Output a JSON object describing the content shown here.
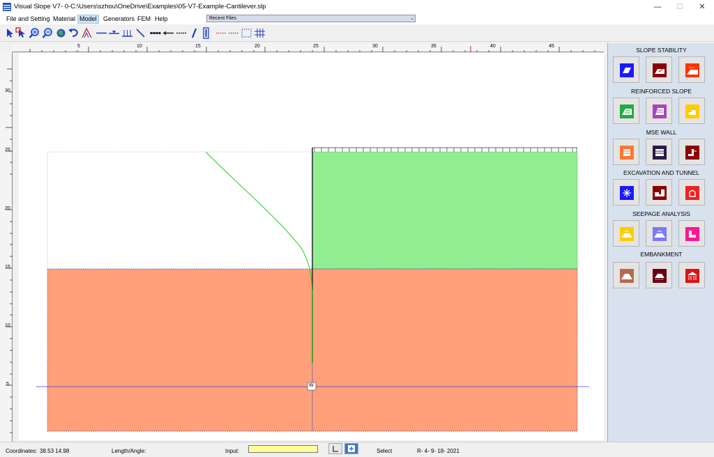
{
  "window": {
    "title": "Visual Slope V7- 0-C:\\Users\\szhou\\OneDrive\\Examples\\05-V7-Example-Cantilever.slp",
    "min_glyph": "—",
    "max_glyph": "☐",
    "close_glyph": "✕"
  },
  "menu": {
    "items": [
      "File and Setting",
      "Material",
      "Model",
      "Generators",
      "FEM",
      "Help"
    ],
    "active": "Model",
    "recent_files": "Recent Files",
    "dropdown_glyph": "⌄"
  },
  "toolbar": {
    "icons": [
      "select-arrow-icon",
      "select-point-icon",
      "zoom-in-icon",
      "zoom-out-icon",
      "globe-icon",
      "undo-icon",
      "slope-icon",
      "line-icon",
      "water-table-icon",
      "load-icon",
      "diagonal-line-icon",
      "anchor-icon",
      "nail-icon",
      "geotextile-icon",
      "pile-icon",
      "wall-icon",
      "red-dash-icon",
      "blue-dash-icon",
      "dashed-box-icon",
      "grid-icon"
    ]
  },
  "ruler": {
    "x_labels": [
      "5",
      "10",
      "15",
      "20",
      "25",
      "30",
      "35",
      "40",
      "45"
    ],
    "y_labels": [
      "30",
      "25",
      "20",
      "15",
      "10",
      "5"
    ]
  },
  "canvas": {
    "water_label": "W",
    "colors": {
      "retained_soil": "#90ee90",
      "foundation_soil": "#ffa07a",
      "deflection_curve": "#22cc22",
      "water_line": "#4444dd",
      "wall": "#333333"
    }
  },
  "sidepanel": {
    "sections": [
      {
        "title": "SLOPE STABILITY",
        "buttons": [
          {
            "name": "slope-stability-1-icon",
            "color": "#1a1aff"
          },
          {
            "name": "slope-stability-2-icon",
            "color": "#8b0000"
          },
          {
            "name": "slope-stability-3-icon",
            "color": "#ff3300"
          }
        ]
      },
      {
        "title": "REINFORCED SLOPE",
        "buttons": [
          {
            "name": "reinforced-slope-1-icon",
            "color": "#22aa44"
          },
          {
            "name": "reinforced-slope-2-icon",
            "color": "#aa44bb"
          },
          {
            "name": "reinforced-slope-3-icon",
            "color": "#ffcc00"
          }
        ]
      },
      {
        "title": "MSE WALL",
        "buttons": [
          {
            "name": "mse-wall-1-icon",
            "color": "#ff7733"
          },
          {
            "name": "mse-wall-2-icon",
            "color": "#2a1a4a"
          },
          {
            "name": "mse-wall-3-icon",
            "color": "#8b0000"
          }
        ]
      },
      {
        "title": "EXCAVATION AND TUNNEL",
        "buttons": [
          {
            "name": "excavation-1-icon",
            "color": "#1a1aff"
          },
          {
            "name": "excavation-2-icon",
            "color": "#8b0000"
          },
          {
            "name": "tunnel-icon",
            "color": "#ee2222"
          }
        ]
      },
      {
        "title": "SEEPAGE ANALYSIS",
        "buttons": [
          {
            "name": "seepage-1-icon",
            "color": "#ffcc00"
          },
          {
            "name": "seepage-2-icon",
            "color": "#7a7aff"
          },
          {
            "name": "seepage-3-icon",
            "color": "#ff1493"
          }
        ]
      },
      {
        "title": "EMBANKMENT",
        "buttons": [
          {
            "name": "embankment-1-icon",
            "color": "#b86b4b"
          },
          {
            "name": "embankment-2-icon",
            "color": "#6b0010"
          },
          {
            "name": "embankment-3-icon",
            "color": "#dd1111"
          }
        ]
      }
    ]
  },
  "status": {
    "coordinates_label": "Coordinates:",
    "coordinates_value": "38.53  14.98",
    "length_label": "Length/Angle:",
    "input_label": "Input:",
    "mode": "Select",
    "version": "R- 4- 9- 18- 2021"
  }
}
